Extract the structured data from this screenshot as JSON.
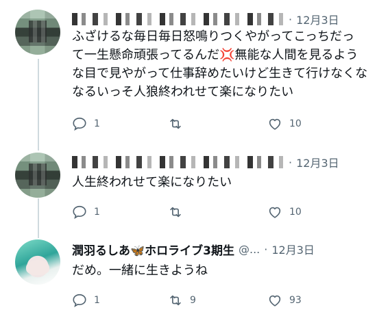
{
  "tweets": [
    {
      "author_name": "",
      "handle": "",
      "date": "12月3日",
      "text_lines": [
        "ふざけるな毎日毎日怒鳴りつくやがってこっちだっ",
        "て一生懸命頑張ってるんだ💢無能な人間を見るよう",
        "な目で見やがって仕事辞めたいけど生きて行けなくな",
        "なるいっそ人狼終われせて楽になりたい"
      ],
      "reply_count": "1",
      "retweet_count": "",
      "like_count": "10"
    },
    {
      "author_name": "",
      "handle": "",
      "date": "12月3日",
      "text_lines": [
        "人生終われせて楽になりたい"
      ],
      "reply_count": "1",
      "retweet_count": "",
      "like_count": "10"
    },
    {
      "author_name": "潤羽るしあ🦋ホロライブ3期生",
      "handle": "@...",
      "date": "12月3日",
      "text_lines": [
        "だめ。一緒に生きようね"
      ],
      "reply_count": "1",
      "retweet_count": "9",
      "like_count": "93"
    }
  ],
  "separator": "·",
  "icons": [
    "reply-icon",
    "retweet-icon",
    "like-icon"
  ]
}
